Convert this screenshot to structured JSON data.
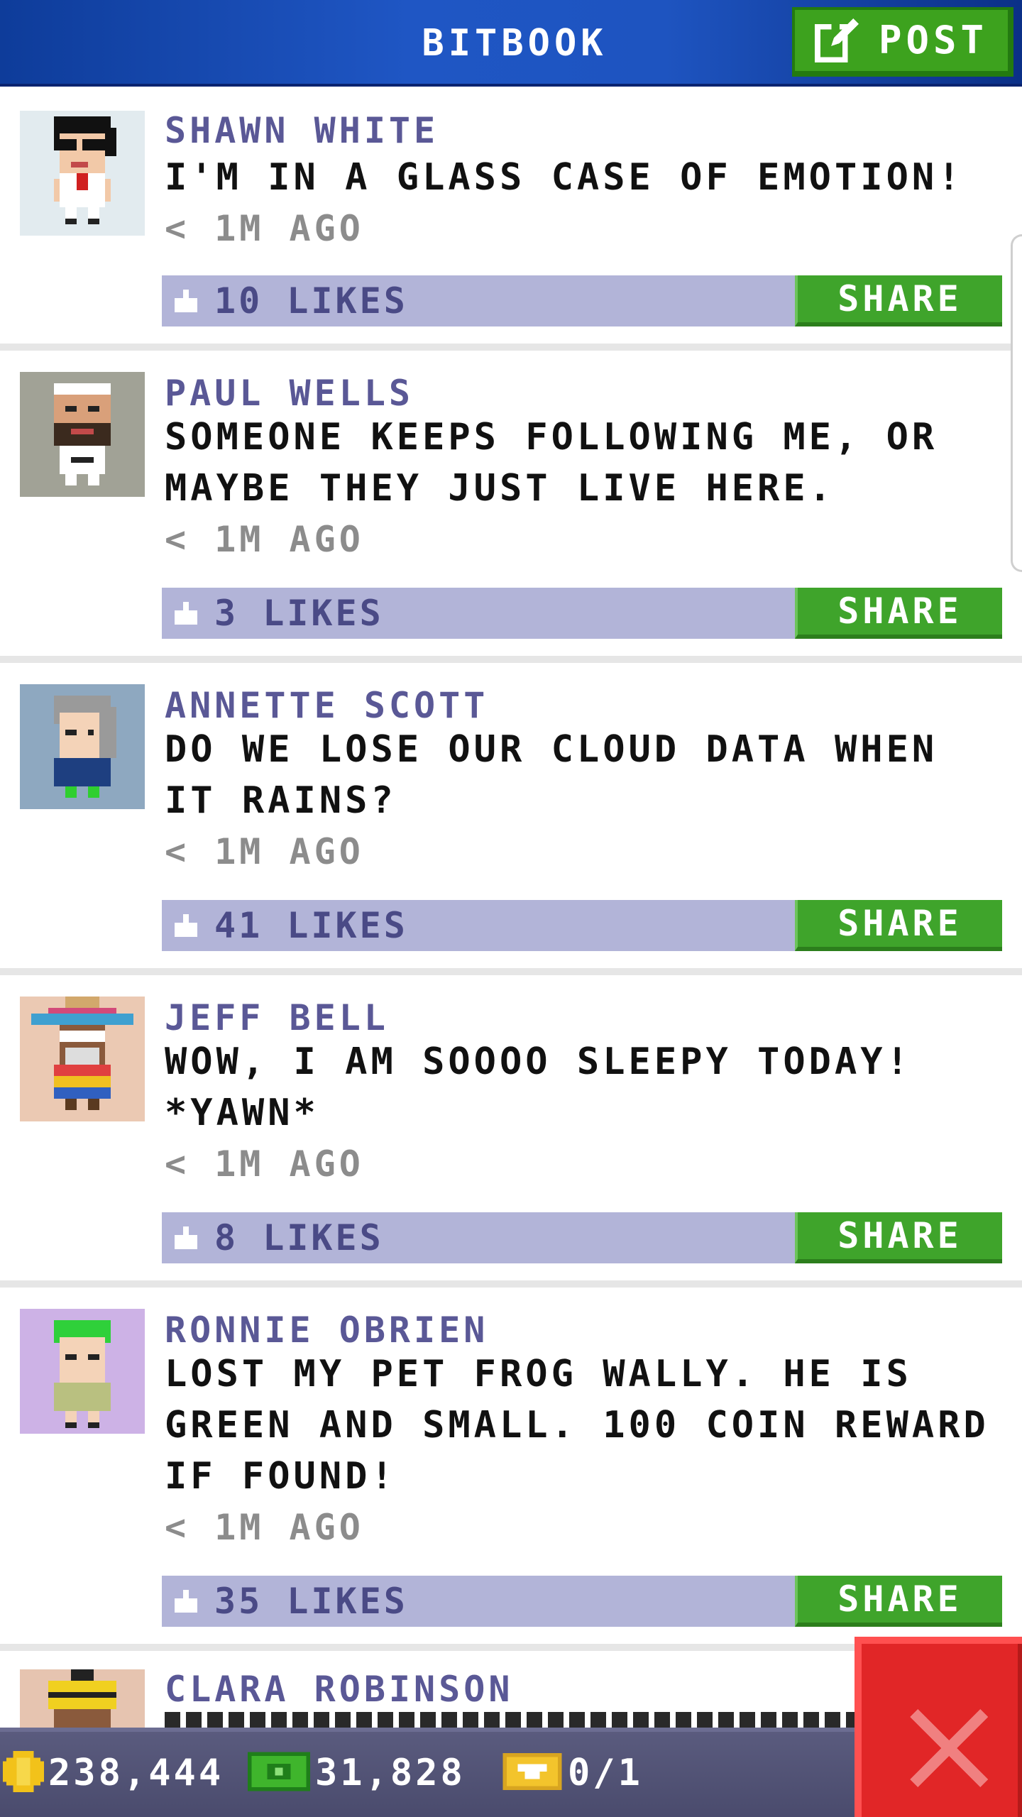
{
  "header": {
    "title": "BITBOOK",
    "post_label": "POST"
  },
  "colors": {
    "header_blue": "#1f56c4",
    "share_green": "#3fa42b",
    "likes_bar": "#b2b4d8",
    "author_purple": "#5a5896",
    "close_red": "#e12627"
  },
  "posts": [
    {
      "author": "SHAWN WHITE",
      "message": "I'M IN A GLASS CASE OF EMOTION!",
      "time": "< 1M AGO",
      "likes": "10 LIKES",
      "share": "SHARE",
      "avatar": "avatar-shawn-white"
    },
    {
      "author": "PAUL WELLS",
      "message": "SOMEONE KEEPS FOLLOWING ME, OR MAYBE THEY JUST LIVE HERE.",
      "time": "< 1M AGO",
      "likes": "3 LIKES",
      "share": "SHARE",
      "avatar": "avatar-paul-wells"
    },
    {
      "author": "ANNETTE SCOTT",
      "message": "DO WE LOSE OUR CLOUD DATA WHEN IT RAINS?",
      "time": "< 1M AGO",
      "likes": "41 LIKES",
      "share": "SHARE",
      "avatar": "avatar-annette-scott"
    },
    {
      "author": "JEFF BELL",
      "message": "WOW, I AM SOOOO SLEEPY TODAY! *YAWN*",
      "time": "< 1M AGO",
      "likes": "8 LIKES",
      "share": "SHARE",
      "avatar": "avatar-jeff-bell"
    },
    {
      "author": "RONNIE OBRIEN",
      "message": "LOST MY PET FROG WALLY. HE IS GREEN AND SMALL. 100 COIN REWARD IF FOUND!",
      "time": "< 1M AGO",
      "likes": "35 LIKES",
      "share": "SHARE",
      "avatar": "avatar-ronnie-obrien"
    },
    {
      "author": "CLARA ROBINSON",
      "avatar": "avatar-clara-robinson"
    }
  ],
  "status_bar": {
    "coins": "238,444",
    "bux": "31,828",
    "tickets": "0/1",
    "icons": [
      "coin-icon",
      "bux-icon",
      "ticket-icon"
    ]
  },
  "close_button_icon": "close-icon"
}
